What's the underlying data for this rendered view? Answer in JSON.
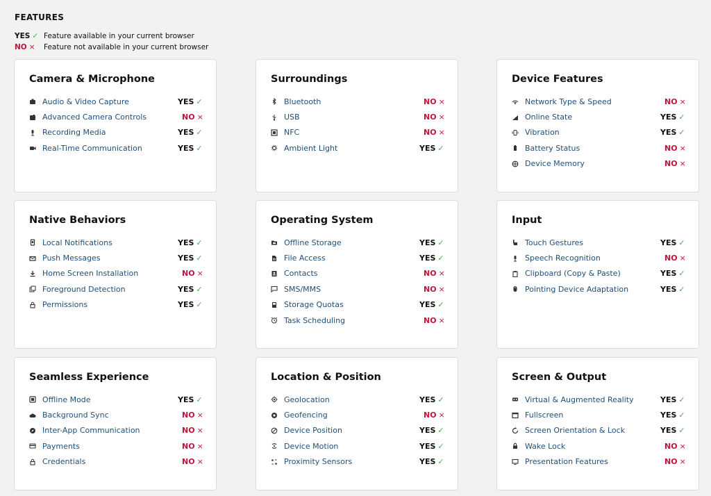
{
  "heading": "FEATURES",
  "legend": [
    {
      "status": "YES",
      "mark": "✓",
      "description": "Feature available in your current browser"
    },
    {
      "status": "NO",
      "mark": "×",
      "description": "Feature not available in your current browser"
    }
  ],
  "colors": {
    "yes_text": "#111111",
    "yes_mark": "#4caf50",
    "no": "#c0143c",
    "label": "#1f4e79"
  },
  "cards": [
    {
      "title": "Camera & Microphone",
      "items": [
        {
          "label": "Audio & Video Capture",
          "status": "YES",
          "mark": "✓",
          "icon": "camera-icon"
        },
        {
          "label": "Advanced Camera Controls",
          "status": "NO",
          "mark": "×",
          "icon": "camera-controls-icon"
        },
        {
          "label": "Recording Media",
          "status": "YES",
          "mark": "✓",
          "icon": "microphone-icon"
        },
        {
          "label": "Real-Time Communication",
          "status": "YES",
          "mark": "✓",
          "icon": "video-call-icon"
        }
      ]
    },
    {
      "title": "Surroundings",
      "items": [
        {
          "label": "Bluetooth",
          "status": "NO",
          "mark": "×",
          "icon": "bluetooth-icon"
        },
        {
          "label": "USB",
          "status": "NO",
          "mark": "×",
          "icon": "usb-icon"
        },
        {
          "label": "NFC",
          "status": "NO",
          "mark": "×",
          "icon": "nfc-icon"
        },
        {
          "label": "Ambient Light",
          "status": "YES",
          "mark": "✓",
          "icon": "light-icon"
        }
      ]
    },
    {
      "title": "Device Features",
      "items": [
        {
          "label": "Network Type & Speed",
          "status": "NO",
          "mark": "×",
          "icon": "network-icon"
        },
        {
          "label": "Online State",
          "status": "YES",
          "mark": "✓",
          "icon": "signal-icon"
        },
        {
          "label": "Vibration",
          "status": "YES",
          "mark": "✓",
          "icon": "vibration-icon"
        },
        {
          "label": "Battery Status",
          "status": "NO",
          "mark": "×",
          "icon": "battery-icon"
        },
        {
          "label": "Device Memory",
          "status": "NO",
          "mark": "×",
          "icon": "memory-icon"
        }
      ]
    },
    {
      "title": "Native Behaviors",
      "items": [
        {
          "label": "Local Notifications",
          "status": "YES",
          "mark": "✓",
          "icon": "notification-icon"
        },
        {
          "label": "Push Messages",
          "status": "YES",
          "mark": "✓",
          "icon": "push-icon"
        },
        {
          "label": "Home Screen Installation",
          "status": "NO",
          "mark": "×",
          "icon": "download-icon"
        },
        {
          "label": "Foreground Detection",
          "status": "YES",
          "mark": "✓",
          "icon": "windows-icon"
        },
        {
          "label": "Permissions",
          "status": "YES",
          "mark": "✓",
          "icon": "lock-icon"
        }
      ]
    },
    {
      "title": "Operating System",
      "items": [
        {
          "label": "Offline Storage",
          "status": "YES",
          "mark": "✓",
          "icon": "folder-icon"
        },
        {
          "label": "File Access",
          "status": "YES",
          "mark": "✓",
          "icon": "file-icon"
        },
        {
          "label": "Contacts",
          "status": "NO",
          "mark": "×",
          "icon": "contacts-icon"
        },
        {
          "label": "SMS/MMS",
          "status": "NO",
          "mark": "×",
          "icon": "message-icon"
        },
        {
          "label": "Storage Quotas",
          "status": "YES",
          "mark": "✓",
          "icon": "storage-icon"
        },
        {
          "label": "Task Scheduling",
          "status": "NO",
          "mark": "×",
          "icon": "alarm-icon"
        }
      ]
    },
    {
      "title": "Input",
      "items": [
        {
          "label": "Touch Gestures",
          "status": "YES",
          "mark": "✓",
          "icon": "touch-icon"
        },
        {
          "label": "Speech Recognition",
          "status": "NO",
          "mark": "×",
          "icon": "microphone-icon"
        },
        {
          "label": "Clipboard (Copy & Paste)",
          "status": "YES",
          "mark": "✓",
          "icon": "clipboard-icon"
        },
        {
          "label": "Pointing Device Adaptation",
          "status": "YES",
          "mark": "✓",
          "icon": "mouse-icon"
        }
      ]
    },
    {
      "title": "Seamless Experience",
      "items": [
        {
          "label": "Offline Mode",
          "status": "YES",
          "mark": "✓",
          "icon": "offline-icon"
        },
        {
          "label": "Background Sync",
          "status": "NO",
          "mark": "×",
          "icon": "cloud-icon"
        },
        {
          "label": "Inter-App Communication",
          "status": "NO",
          "mark": "×",
          "icon": "compass-icon"
        },
        {
          "label": "Payments",
          "status": "NO",
          "mark": "×",
          "icon": "credit-card-icon"
        },
        {
          "label": "Credentials",
          "status": "NO",
          "mark": "×",
          "icon": "lock-icon"
        }
      ]
    },
    {
      "title": "Location & Position",
      "items": [
        {
          "label": "Geolocation",
          "status": "YES",
          "mark": "✓",
          "icon": "crosshair-icon"
        },
        {
          "label": "Geofencing",
          "status": "NO",
          "mark": "×",
          "icon": "geofence-icon"
        },
        {
          "label": "Device Position",
          "status": "YES",
          "mark": "✓",
          "icon": "orientation-icon"
        },
        {
          "label": "Device Motion",
          "status": "YES",
          "mark": "✓",
          "icon": "motion-icon"
        },
        {
          "label": "Proximity Sensors",
          "status": "YES",
          "mark": "✓",
          "icon": "proximity-icon"
        }
      ]
    },
    {
      "title": "Screen & Output",
      "items": [
        {
          "label": "Virtual & Augmented Reality",
          "status": "YES",
          "mark": "✓",
          "icon": "vr-icon"
        },
        {
          "label": "Fullscreen",
          "status": "YES",
          "mark": "✓",
          "icon": "fullscreen-icon"
        },
        {
          "label": "Screen Orientation & Lock",
          "status": "YES",
          "mark": "✓",
          "icon": "rotate-icon"
        },
        {
          "label": "Wake Lock",
          "status": "NO",
          "mark": "×",
          "icon": "padlock-icon"
        },
        {
          "label": "Presentation Features",
          "status": "NO",
          "mark": "×",
          "icon": "monitor-icon"
        }
      ]
    }
  ]
}
